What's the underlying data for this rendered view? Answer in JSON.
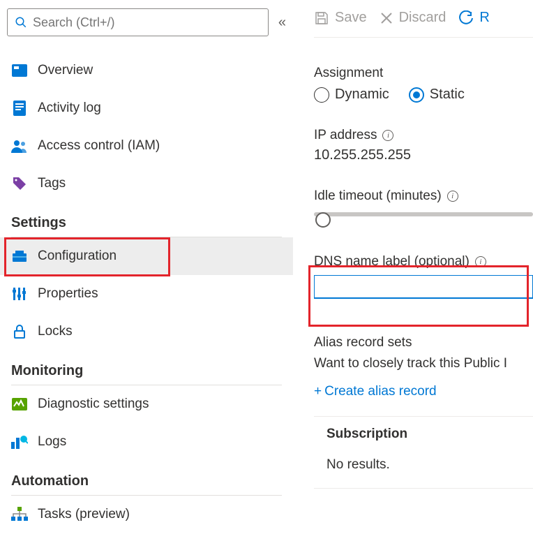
{
  "search": {
    "placeholder": "Search (Ctrl+/)"
  },
  "sidebar": {
    "items": [
      {
        "label": "Overview"
      },
      {
        "label": "Activity log"
      },
      {
        "label": "Access control (IAM)"
      },
      {
        "label": "Tags"
      }
    ],
    "settings_header": "Settings",
    "settings": [
      {
        "label": "Configuration"
      },
      {
        "label": "Properties"
      },
      {
        "label": "Locks"
      }
    ],
    "monitoring_header": "Monitoring",
    "monitoring": [
      {
        "label": "Diagnostic settings"
      },
      {
        "label": "Logs"
      }
    ],
    "automation_header": "Automation",
    "automation": [
      {
        "label": "Tasks (preview)"
      }
    ]
  },
  "toolbar": {
    "save": "Save",
    "discard": "Discard",
    "refresh": "R"
  },
  "main": {
    "assignment_label": "Assignment",
    "assignment_options": {
      "dynamic": "Dynamic",
      "static": "Static"
    },
    "assignment_selected": "static",
    "ip_label": "IP address",
    "ip_value": "10.255.255.255",
    "idle_label": "Idle timeout (minutes)",
    "dns_label": "DNS name label (optional)",
    "dns_value": "",
    "alias_heading": "Alias record sets",
    "alias_text": "Want to closely track this Public I",
    "create_alias": "Create alias record",
    "subscription_label": "Subscription",
    "subscription_empty": "No results."
  }
}
